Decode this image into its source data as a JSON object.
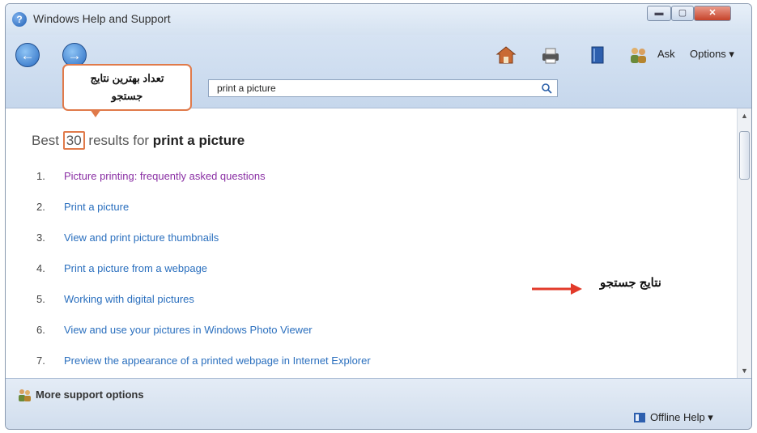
{
  "window": {
    "title": "Windows Help and Support",
    "controls": {
      "minimize": "▬",
      "maximize": "▢",
      "close": "✕"
    }
  },
  "toolbar": {
    "back_icon": "arrow-left-icon",
    "forward_icon": "arrow-right-icon",
    "ask_label": "Ask",
    "options_label": "Options ▾"
  },
  "search": {
    "value": "print a picture"
  },
  "callout": {
    "line1": "تعداد بهترین نتایج",
    "line2": "جستجو"
  },
  "results_header": {
    "prefix": "Best",
    "count": "30",
    "middle": "results for",
    "query": "print a picture"
  },
  "results": [
    {
      "num": "1.",
      "title": "Picture printing: frequently asked questions",
      "visited": true
    },
    {
      "num": "2.",
      "title": "Print a picture",
      "visited": false
    },
    {
      "num": "3.",
      "title": "View and print picture thumbnails",
      "visited": false
    },
    {
      "num": "4.",
      "title": "Print a picture from a webpage",
      "visited": false
    },
    {
      "num": "5.",
      "title": "Working with digital pictures",
      "visited": false
    },
    {
      "num": "6.",
      "title": "View and use your pictures in Windows Photo Viewer",
      "visited": false
    },
    {
      "num": "7.",
      "title": "Preview the appearance of a printed webpage in Internet Explorer",
      "visited": false
    }
  ],
  "annotation": {
    "text": "نتایج جستجو",
    "arrow_color": "#e23a2a"
  },
  "footer": {
    "more_support": "More support options",
    "offline_help": "Offline Help ▾"
  },
  "colors": {
    "link": "#2a6fbe",
    "visited_link": "#8a2fa4",
    "highlight": "#e07a4a"
  }
}
